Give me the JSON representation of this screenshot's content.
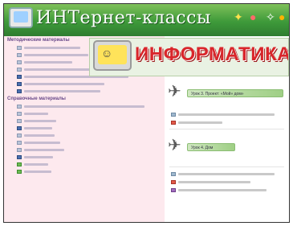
{
  "header": {
    "title": "ИНТернет-классы"
  },
  "logo": {
    "word": "ИНФОРМАТИКА"
  },
  "sidebar": {
    "section1_title": "Методические материалы",
    "section1_items": [
      {
        "icon": "doc",
        "text": "",
        "bar_width": 70
      },
      {
        "icon": "doc",
        "text": "",
        "bar_width": 80
      },
      {
        "icon": "doc",
        "text": "",
        "bar_width": 60
      },
      {
        "icon": "doc",
        "text": "",
        "bar_width": 110
      },
      {
        "icon": "pencil",
        "text": "",
        "bar_width": 130
      },
      {
        "icon": "pencil",
        "text": "",
        "bar_width": 100
      },
      {
        "icon": "pencil",
        "text": "",
        "bar_width": 95
      }
    ],
    "section2_title": "Справочные материалы",
    "section2_items": [
      {
        "icon": "doc",
        "text": "",
        "bar_width": 150
      },
      {
        "icon": "doc",
        "text": "",
        "bar_width": 30
      },
      {
        "icon": "doc",
        "text": "",
        "bar_width": 40
      },
      {
        "icon": "pencil",
        "text": "",
        "bar_width": 35
      },
      {
        "icon": "doc",
        "text": "",
        "bar_width": 38
      },
      {
        "icon": "doc",
        "text": "",
        "bar_width": 45
      },
      {
        "icon": "doc",
        "text": "",
        "bar_width": 50
      },
      {
        "icon": "pencil",
        "text": "",
        "bar_width": 36
      },
      {
        "icon": "green",
        "text": "",
        "bar_width": 30
      },
      {
        "icon": "green",
        "text": "",
        "bar_width": 34
      }
    ]
  },
  "content": {
    "lesson1": {
      "label": "Урок 3.   Проект: «Мой» дом»"
    },
    "lesson1_links": [
      {
        "icon": "doc",
        "bar_width": 120
      },
      {
        "icon": "red",
        "bar_width": 55
      }
    ],
    "lesson2": {
      "label": "Урок 4.   Дом"
    },
    "lesson2_links": [
      {
        "icon": "doc",
        "bar_width": 120
      },
      {
        "icon": "red",
        "bar_width": 90
      },
      {
        "icon": "purple",
        "bar_width": 110
      }
    ]
  },
  "colors": {
    "header_green": "#3e9a3a",
    "sidebar_bg": "#fde9ee",
    "logo_red": "#d9262b",
    "pill_green": "#9fcf85"
  }
}
